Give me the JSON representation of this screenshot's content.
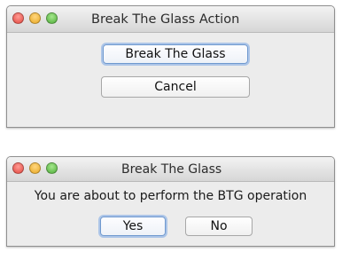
{
  "action_dialog": {
    "title": "Break The Glass Action",
    "break_button_label": "Break The Glass",
    "cancel_button_label": "Cancel"
  },
  "confirm_dialog": {
    "title": "Break The Glass",
    "message": "You are about to perform the BTG operation",
    "yes_button_label": "Yes",
    "no_button_label": "No"
  },
  "colors": {
    "close_light": "#e2473f",
    "minimize_light": "#e9a823",
    "zoom_light": "#4fad39",
    "default_button_ring": "#6f99cf"
  }
}
